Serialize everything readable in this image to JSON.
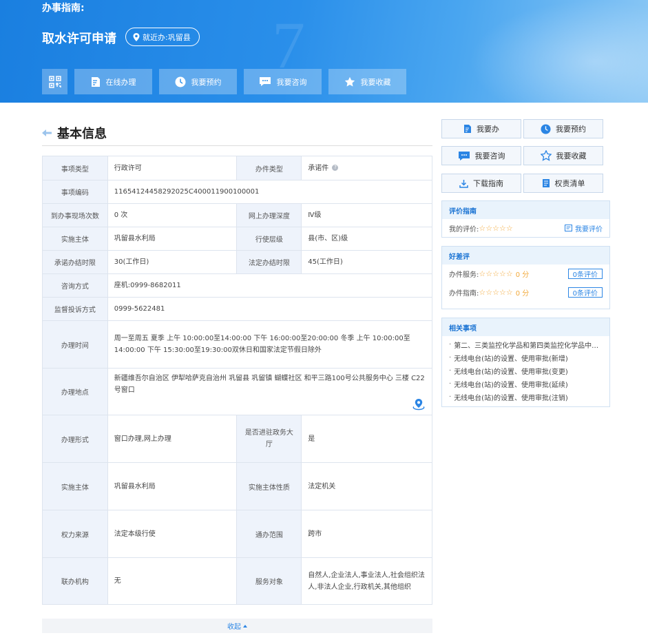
{
  "header": {
    "guide_label": "办事指南:",
    "title": "取水许可申请",
    "nearby_label": "就近办:巩留县",
    "actions": [
      {
        "label": "在线办理",
        "icon": "edit-icon"
      },
      {
        "label": "我要预约",
        "icon": "clock-icon"
      },
      {
        "label": "我要咨询",
        "icon": "chat-icon"
      },
      {
        "label": "我要收藏",
        "icon": "star-icon"
      }
    ]
  },
  "section": {
    "title": "基本信息"
  },
  "info": {
    "item_type_k": "事项类型",
    "item_type_v": "行政许可",
    "handle_type_k": "办件类型",
    "handle_type_v": "承诺件",
    "code_k": "事项编码",
    "code_v": "11654124458292025C400011900100001",
    "visits_k": "到办事现场次数",
    "visits_v": "0 次",
    "online_depth_k": "网上办理深度",
    "online_depth_v": "Ⅳ级",
    "subject_k": "实施主体",
    "subject_v": "巩留县水利局",
    "level_k": "行使层级",
    "level_v": "县(市、区)级",
    "promise_k": "承诺办结时限",
    "promise_v": "30(工作日)",
    "legal_k": "法定办结时限",
    "legal_v": "45(工作日)",
    "consult_k": "咨询方式",
    "consult_v": "座机:0999-8682011",
    "complaint_k": "监督投诉方式",
    "complaint_v": "0999-5622481",
    "time_k": "办理时间",
    "time_v": "周一至周五 夏季 上午 10:00:00至14:00:00 下午 16:00:00至20:00:00 冬季 上午 10:00:00至14:00:00 下午 15:30:00至19:30:00双休日和国家法定节假日除外",
    "place_k": "办理地点",
    "place_v": "新疆维吾尔自治区 伊犁哈萨克自治州 巩留县 巩留镇 蝴蝶社区 和平三路100号公共服务中心 三楼 C22号窗口",
    "form_k": "办理形式",
    "form_v": "窗口办理,网上办理",
    "hall_k": "是否进驻政务大厅",
    "hall_v": "是",
    "subject2_k": "实施主体",
    "subject2_v": "巩留县水利局",
    "nature_k": "实施主体性质",
    "nature_v": "法定机关",
    "power_k": "权力来源",
    "power_v": "法定本级行使",
    "scope_k": "通办范围",
    "scope_v": "跨市",
    "joint_k": "联办机构",
    "joint_v": "无",
    "target_k": "服务对象",
    "target_v": "自然人,企业法人,事业法人,社会组织法人,非法人企业,行政机关,其他组织"
  },
  "collapse_label": "收起",
  "side_buttons": [
    {
      "label": "我要办",
      "icon": "edit-icon"
    },
    {
      "label": "我要预约",
      "icon": "clock-icon"
    },
    {
      "label": "我要咨询",
      "icon": "chat-icon"
    },
    {
      "label": "我要收藏",
      "icon": "star-icon"
    },
    {
      "label": "下载指南",
      "icon": "download-icon"
    },
    {
      "label": "权责清单",
      "icon": "list-icon"
    }
  ],
  "evaluation": {
    "title": "评价指南",
    "my_rating_label": "我的评价:",
    "rate_link": "我要评价"
  },
  "good_bad": {
    "title": "好差评",
    "service_label": "办件服务:",
    "service_score": "0 分",
    "service_count": "0条评价",
    "guide_label": "办件指南:",
    "guide_score": "0 分",
    "guide_count": "0条评价"
  },
  "related": {
    "title": "相关事项",
    "items": [
      "第二、三类监控化学品和第四类监控化学品中…",
      "无线电台(站)的设置、使用审批(新增)",
      "无线电台(站)的设置、使用审批(变更)",
      "无线电台(站)的设置、使用审批(延续)",
      "无线电台(站)的设置、使用审批(注销)"
    ]
  },
  "colors": {
    "accent": "#2b85e4",
    "star": "#f2a93b"
  }
}
